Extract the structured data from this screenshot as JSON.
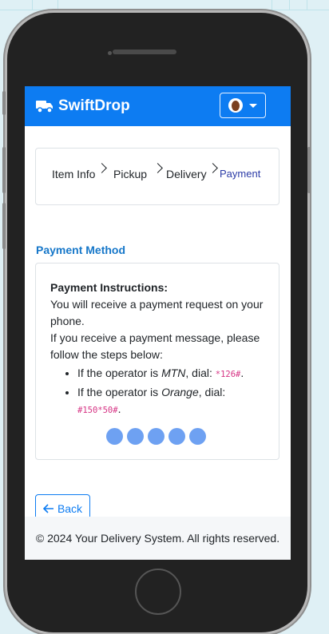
{
  "brand": {
    "name": "SwiftDrop"
  },
  "steps": [
    {
      "label": "Item Info"
    },
    {
      "label": "Pickup"
    },
    {
      "label": "Delivery"
    },
    {
      "label": "Payment"
    }
  ],
  "colors": {
    "primary": "#0d7cf2",
    "active_step": "#2a3aa6",
    "loading_dots": "#6ea1f2",
    "code": "#d63384"
  },
  "payment": {
    "section_title": "Payment Method",
    "instructions_title": "Payment Instructions:",
    "line1": "You will receive a payment request on your phone.",
    "line2": "If you receive a payment message, please follow the steps below:",
    "mtn": {
      "prefix": "If the operator is ",
      "operator": "MTN",
      "mid": ", dial: ",
      "code": "*126#",
      "end": "."
    },
    "orange": {
      "prefix": "If the operator is ",
      "operator": "Orange",
      "mid": ", dial: ",
      "code": "#150*50#",
      "end": "."
    }
  },
  "back_button": {
    "label": "Back",
    "icon": "arrow-left-icon"
  },
  "footer": {
    "text": "© 2024 Your Delivery System. All rights reserved."
  }
}
